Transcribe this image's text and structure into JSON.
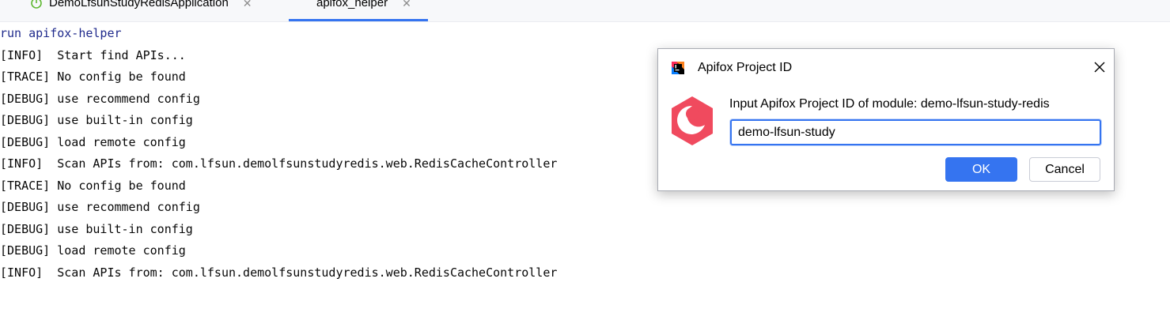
{
  "tabs": [
    {
      "label": "DemoLfsunStudyRedisApplication",
      "icon": "spring-boot-icon",
      "active": false
    },
    {
      "label": "apifox_helper",
      "active": true
    }
  ],
  "console": {
    "lines": [
      "run apifox-helper",
      "[INFO]  Start find APIs...",
      "[TRACE] No config be found",
      "[DEBUG] use recommend config",
      "[DEBUG] use built-in config",
      "[DEBUG] load remote config",
      "[INFO]  Scan APIs from: com.lfsun.demolfsunstudyredis.web.RedisCacheController",
      "[TRACE] No config be found",
      "[DEBUG] use recommend config",
      "[DEBUG] use built-in config",
      "[DEBUG] load remote config",
      "[INFO]  Scan APIs from: com.lfsun.demolfsunstudyredis.web.RedisCacheController"
    ]
  },
  "dialog": {
    "title": "Apifox Project ID",
    "prompt": "Input Apifox Project ID of module: demo-lfsun-study-redis",
    "input_value": "demo-lfsun-study",
    "ok_label": "OK",
    "cancel_label": "Cancel",
    "app_icon": "intellij-icon",
    "logo": "apifox-logo-icon"
  },
  "colors": {
    "accent": "#3574f0",
    "apifox_red": "#f04a5e",
    "command_text": "#1f2a8c"
  }
}
